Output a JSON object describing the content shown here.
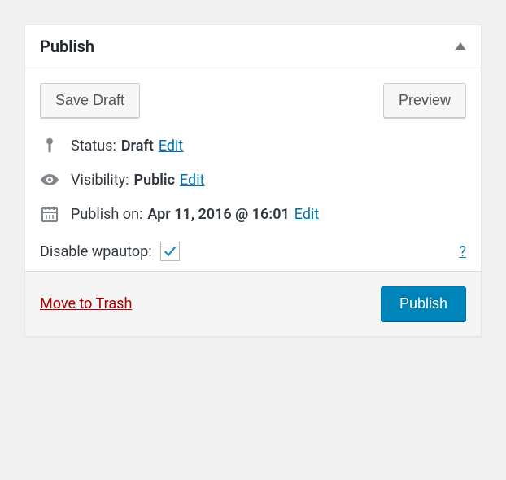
{
  "panel": {
    "title": "Publish"
  },
  "actions": {
    "save_draft": "Save Draft",
    "preview": "Preview",
    "move_to_trash": "Move to Trash",
    "publish": "Publish",
    "help": "?"
  },
  "status": {
    "label": "Status:",
    "value": "Draft",
    "edit": "Edit"
  },
  "visibility": {
    "label": "Visibility:",
    "value": "Public",
    "edit": "Edit"
  },
  "schedule": {
    "label": "Publish on:",
    "value": "Apr 11, 2016 @ 16:01",
    "edit": "Edit"
  },
  "wpautop": {
    "label": "Disable wpautop:",
    "checked": true
  }
}
